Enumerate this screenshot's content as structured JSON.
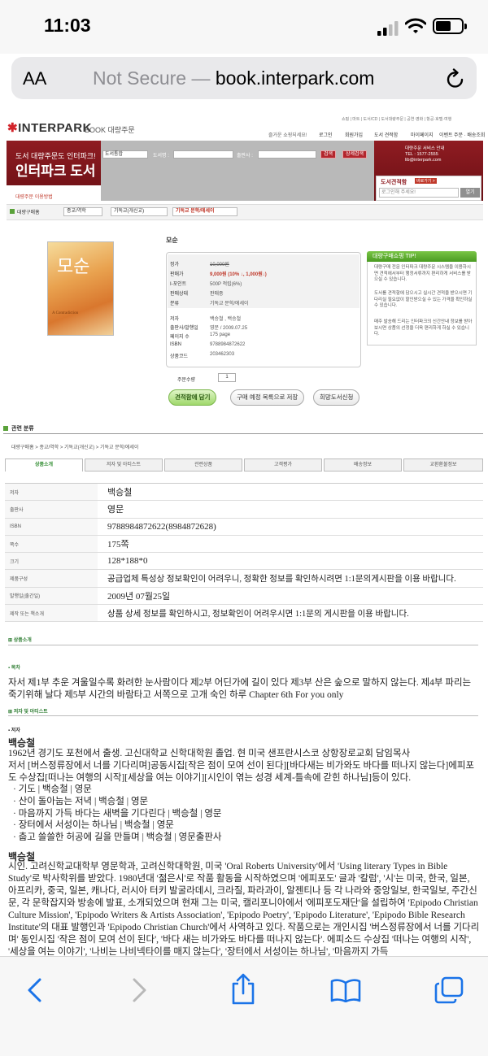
{
  "status": {
    "time": "11:03"
  },
  "browser": {
    "aa": "AA",
    "not_secure": "Not Secure",
    "separator": " — ",
    "domain": "book.interpark.com"
  },
  "site": {
    "logo": "INTERPARK",
    "logo_sub": "BOOK 대량주문",
    "top_links": "쇼핑 | 마트 | 도서/CD | 도서대량주문 | 공연·영화 | 항공·호텔·여행",
    "welcome": "즐거운 쇼핑되세요!",
    "user_links": [
      "로그인",
      "회원가입",
      "도서 견적함",
      "마이페이지",
      "이벤트",
      "주문 · 배송조회"
    ],
    "banner_line1": "도서 대량주문도 인터파크!",
    "banner_line2": "인터파크 도서",
    "banner_howto": "대량주문 이용방법",
    "search": {
      "select": "도서통합",
      "label_book": "도서명 :",
      "label_pub": "출판사 :",
      "search_btn": "검색",
      "detail_btn": "상세검색"
    },
    "service": {
      "title": "대량주문 서비스 안내",
      "tel": "TEL : 1577-2555",
      "email": "lib@interpark.com"
    },
    "request": {
      "title": "도서견적함",
      "more": "바로가기 >",
      "placeholder": "로그인해 주세요!",
      "button": "열기"
    }
  },
  "breadcrumb": [
    "대량구매홈",
    "종교/역학",
    "기독교(개신교)",
    "기독교 문학/에세이"
  ],
  "product": {
    "title": "모순",
    "cover_title": "모순",
    "cover_sub": "A Contradiction",
    "fields": [
      {
        "k": "정가",
        "v": "10,000원"
      },
      {
        "k": "판매가",
        "v": "9,000원 (10% ↓, 1,000원↓)"
      },
      {
        "k": "I-포인트",
        "v": "500P 적립(6%)"
      },
      {
        "k": "판매상태",
        "v": "판매중"
      },
      {
        "k": "분류",
        "v": "기독교 문학/에세이"
      },
      {
        "k": "저자",
        "v": "백승철 , 백승철"
      },
      {
        "k": "출판사/발행일",
        "v": "영문 / 2009.07.25"
      },
      {
        "k": "페이지 수",
        "v": "175 page"
      },
      {
        "k": "ISBN",
        "v": "9788984872622"
      },
      {
        "k": "상품코드",
        "v": "203462303"
      }
    ],
    "qty_label": "주문수량",
    "qty": "1",
    "buttons": {
      "cart": "견적함에 담기",
      "wishlist": "구매 예정 목록으로 저장",
      "library": "희망도서신청"
    }
  },
  "tip": {
    "title": "대량구매쇼핑 TIP!",
    "items": [
      "대량구매 전문 인터파크 대량주문 시스템을 이용하시면 견적에서부터 행정서류까지 편리하게 서비스를 받으실 수 있습니다.",
      "도서를 견적함에 담으시고 실시간 견적을 받으시면 기다리실 필요없이 할인받으실 수 있는 가격을 확인하실 수 있습니다.",
      "매주 발송해 드리는 인터파크의 신간안내 정보를 받아보시면 상품의 선정을 더욱 편리하게 하실 수 있습니다."
    ]
  },
  "related": {
    "heading": "관련 분류",
    "crumb": "대량구매홈 > 종교/역학 > 기독교(개신교) > 기독교 문학/에세이"
  },
  "tabs": [
    "상품소개",
    "저자 및 아티스트",
    "관련상품",
    "고객평가",
    "배송정보",
    "교환환불정보"
  ],
  "specs": [
    {
      "k": "저자",
      "v": "백승철"
    },
    {
      "k": "출판사",
      "v": "영문"
    },
    {
      "k": "ISBN",
      "v": "9788984872622(8984872628)"
    },
    {
      "k": "쪽수",
      "v": "175쪽"
    },
    {
      "k": "크기",
      "v": "128*188*0"
    },
    {
      "k": "제품구성",
      "v": "공급업체 특성상 정보확인이 어려우니, 정확한 정보를 확인하시려면 1:1문의게시판을 이용 바랍니다."
    },
    {
      "k": "발행일(출간일)",
      "v": "2009년 07월25일"
    },
    {
      "k": "제작 또는 책소개",
      "v": "상품 상세 정보를 확인하시고, 정보확인이 어려우시면 1:1문의 게시판을 이용 바랍니다."
    }
  ],
  "sections": {
    "intro": "상품소개",
    "toc": "목차",
    "toc_text": "자서 제1부 추운 겨울일수록 화려한 눈사람이다 제2부 어딘가에 길이 있다 제3부 산은 숲으로 말하지 않는다. 제4부 파리는 죽기위해 날다 제5부 시간의 바람타고 서쪽으로 고개 숙인 하루 Chapter 6th For you only",
    "author_artist": "저자 및 아티스트",
    "author": "저자",
    "author_name": "백승철",
    "author_bio": "1962년 경기도 포천에서 출생. 고신대학교 신학대학원 졸업. 현 미국 샌프란시스코 상항장로교회 담임목사",
    "author_works": "저서 [버스정류장에서 너를 기다리며]공동시집[작은 점이 모여 선이 된다][바다새는 비가와도 바다를 떠나지 않는다]에피포도 수상집[떠나는 여행의 시작][세상을 여는 이야기][시인이 엮는 성경 세계-틀속에 갇힌 하나님]등이 있다.",
    "books": [
      "기도 | 백승철 | 영문",
      "산이 돌아눕는 저녁 | 백승철 | 영문",
      "마음까지 가득 바다는 새벽을 기다린다 | 백승철 | 영문",
      "장터에서 서성이는 하나님 | 백승철 | 영문",
      "춥고 쓸쓸한 허공에 길을 만들며 | 백승철 | 영문출판사"
    ],
    "author_name2": "백승철",
    "author_bio2": "시인. 고려신학교대학부 영문학과, 고려신학대학원, 미국 'Oral Roberts University'에서 'Using literary Types in Bible Study'로 박사학위를 받았다. 1980년대 '젊은시'로 작품 활동을 시작하였으며 '에피포도' 글과 '칼럼', '시'는 미국, 한국, 일본, 아프리카, 중국, 일본, 캐나다, 러시아 터키 발굴라데시, 크라질, 파라과이, 알젠티나 등 각 나라와 중앙일보, 한국일보, 주간신문, 각 문학잡지와 방송에 발표, 소개되었으며 현재 그는 미국, 캘리포니아에서 '에피포도재단'을 설립하여 'Epipodo Christian Culture Mission', 'Epipodo Writers & Artists Association', 'Epipodo Poetry', 'Epipodo Literature', 'Epipodo Bible Research Institute'의 대표 발행인과 'Epipodo Christian Church'에서 사역하고 있다. 작품으로는 개인시집 '버스정류장에서 너를 기다리며' 동인시집 '작은 점이 모여 선이 된다', '바다 새는 비가와도 바다를 떠나지 않는다'. 에피소드 수상집 '떠나는 여행의 시작', '세상을 여는 이야기', '나비는 나비넥타이를 매지 않는다', '장터에서 서성이는 하나님', '마음까지 가득"
  }
}
